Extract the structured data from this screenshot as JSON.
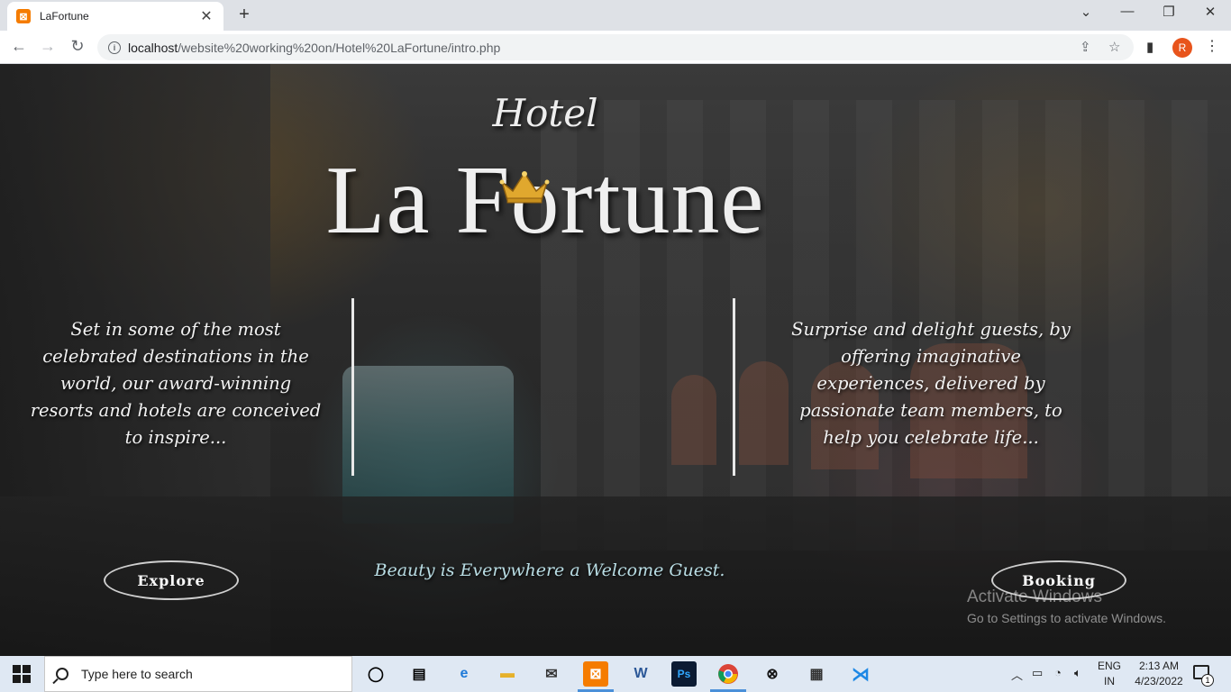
{
  "browser": {
    "tab_title": "LaFortune",
    "tab_favicon": "xampp-icon",
    "url_host": "localhost",
    "url_path": "/website%20working%20on/Hotel%20LaFortune/intro.php",
    "avatar_letter": "R"
  },
  "hero": {
    "pre_title": "Hotel",
    "title": "La Fortune",
    "left_blurb": "Set in some of the most celebrated destinations in the world, our award-winning resorts and hotels are conceived to inspire...",
    "right_blurb": "Surprise and delight guests, by offering imaginative experiences, delivered by passionate team members, to help you celebrate life...",
    "tagline": "Beauty is Everywhere a Welcome Guest.",
    "explore_label": "Explore",
    "booking_label": "Booking",
    "crown_color": "#e0a82e"
  },
  "watermark": {
    "line1": "Activate Windows",
    "line2": "Go to Settings to activate Windows."
  },
  "taskbar": {
    "search_placeholder": "Type here to search",
    "lang_top": "ENG",
    "lang_bottom": "IN",
    "time": "2:13 AM",
    "date": "4/23/2022",
    "notification_count": "1",
    "apps": [
      "task-view",
      "widgets",
      "edge",
      "file-explorer",
      "mail",
      "xampp",
      "word",
      "photoshop",
      "chrome",
      "xbox",
      "store",
      "vscode"
    ]
  }
}
